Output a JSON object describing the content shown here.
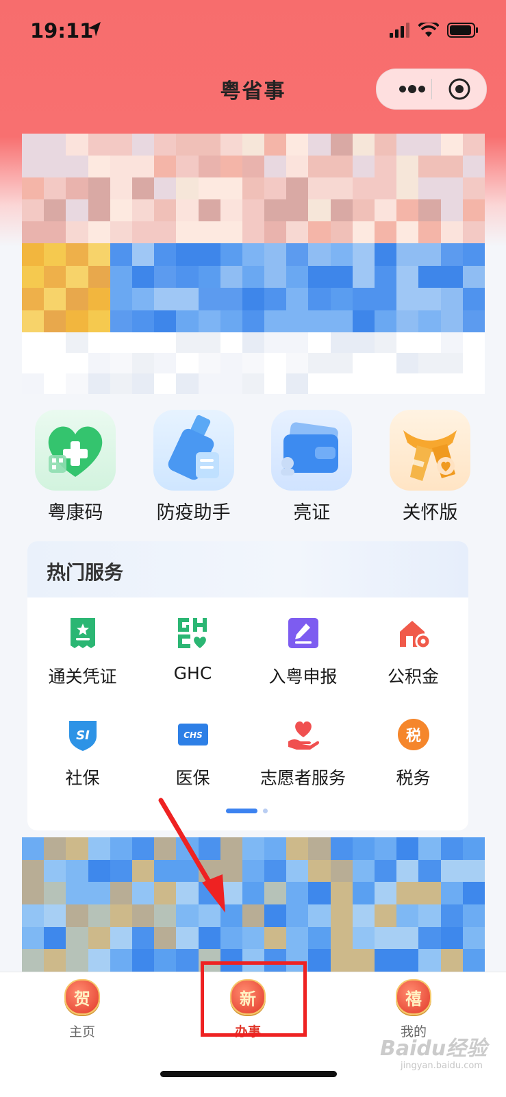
{
  "status_bar": {
    "time": "19:11"
  },
  "app": {
    "title": "粤省事"
  },
  "quick_actions": [
    {
      "label": "粤康码",
      "icon": "green-heart-qr-icon"
    },
    {
      "label": "防疫助手",
      "icon": "blue-spray-bottle-icon"
    },
    {
      "label": "亮证",
      "icon": "blue-card-wallet-icon"
    },
    {
      "label": "关怀版",
      "icon": "orange-scarf-icon"
    }
  ],
  "hot_services": {
    "title": "热门服务",
    "items": [
      {
        "label": "通关凭证",
        "icon": "green-certificate-icon"
      },
      {
        "label": "GHC",
        "icon": "green-ghc-logo-icon"
      },
      {
        "label": "入粤申报",
        "icon": "purple-edit-icon"
      },
      {
        "label": "公积金",
        "icon": "red-house-icon"
      },
      {
        "label": "社保",
        "icon": "blue-si-shield-icon"
      },
      {
        "label": "医保",
        "icon": "blue-chs-card-icon"
      },
      {
        "label": "志愿者服务",
        "icon": "red-heart-hand-icon"
      },
      {
        "label": "税务",
        "icon": "orange-tax-coin-icon",
        "glyph": "税"
      }
    ],
    "current_page": 1,
    "page_count": 2
  },
  "tabbar": {
    "tabs": [
      {
        "label": "主页",
        "glyph": "贺",
        "active": false
      },
      {
        "label": "办事",
        "glyph": "新",
        "active": true
      },
      {
        "label": "我的",
        "glyph": "禧",
        "active": false
      }
    ]
  },
  "watermark": {
    "brand": "Baidu经验",
    "url": "jingyan.baidu.com"
  },
  "colors": {
    "header": "#f76d6d",
    "accent_blue": "#3c82f0",
    "active_tab": "#e0362a",
    "highlight": "#ee2222"
  }
}
